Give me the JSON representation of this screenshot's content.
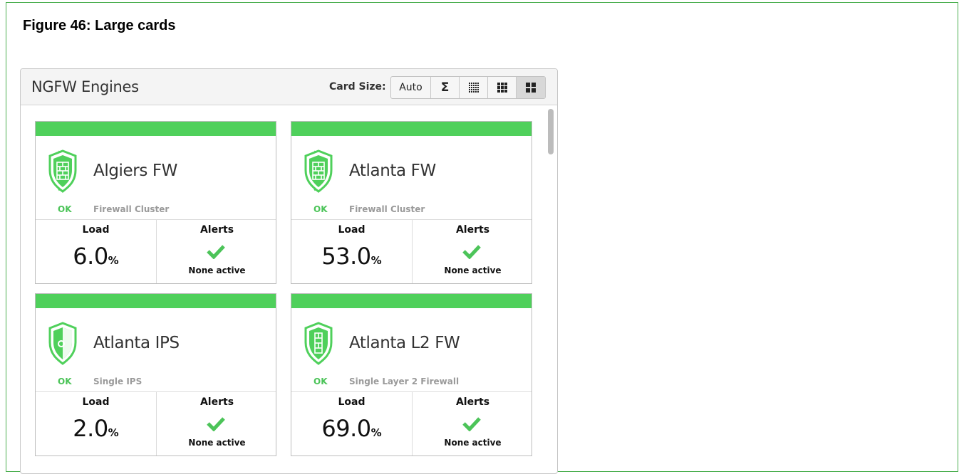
{
  "figure_caption": "Figure 46: Large cards",
  "panel": {
    "title": "NGFW Engines",
    "card_size_label": "Card Size:",
    "size_buttons": [
      {
        "label": "Auto",
        "icon": "text",
        "active": false
      },
      {
        "label": "Σ",
        "icon": "sigma-icon",
        "active": false
      },
      {
        "label": "",
        "icon": "grid-small-icon",
        "active": false
      },
      {
        "label": "",
        "icon": "grid-medium-icon",
        "active": false
      },
      {
        "label": "",
        "icon": "grid-large-icon",
        "active": true
      }
    ]
  },
  "colors": {
    "status_green": "#4fd05b",
    "ok_text": "#4cc459",
    "frame_border": "#4caf50"
  },
  "cards": [
    {
      "name": "Algiers FW",
      "status": "OK",
      "type": "Firewall Cluster",
      "load_label": "Load",
      "load_value": "6.0",
      "load_unit": "%",
      "alerts_label": "Alerts",
      "alerts_status": "None active",
      "icon": "firewall-cluster-icon"
    },
    {
      "name": "Atlanta FW",
      "status": "OK",
      "type": "Firewall Cluster",
      "load_label": "Load",
      "load_value": "53.0",
      "load_unit": "%",
      "alerts_label": "Alerts",
      "alerts_status": "None active",
      "icon": "firewall-cluster-icon"
    },
    {
      "name": "Atlanta IPS",
      "status": "OK",
      "type": "Single IPS",
      "load_label": "Load",
      "load_value": "2.0",
      "load_unit": "%",
      "alerts_label": "Alerts",
      "alerts_status": "None active",
      "icon": "ips-shield-icon"
    },
    {
      "name": "Atlanta L2 FW",
      "status": "OK",
      "type": "Single Layer 2 Firewall",
      "load_label": "Load",
      "load_value": "69.0",
      "load_unit": "%",
      "alerts_label": "Alerts",
      "alerts_status": "None active",
      "icon": "l2-firewall-icon"
    }
  ]
}
